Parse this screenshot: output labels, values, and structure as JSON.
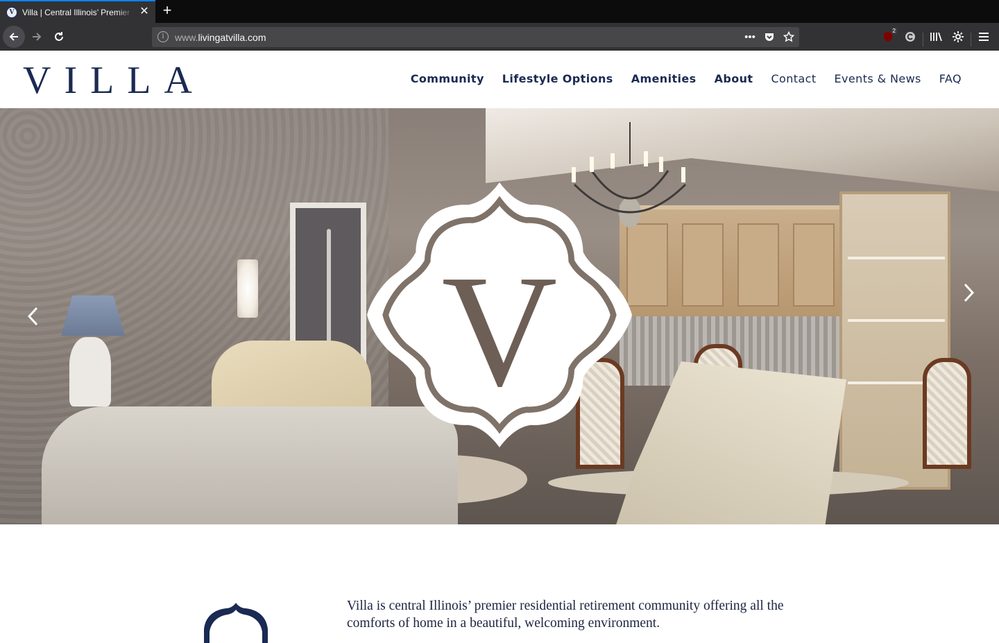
{
  "browser": {
    "tab_title": "Villa | Central Illinois’ Premier Residential Retirement Community",
    "tab_favicon_letter": "V",
    "url_dim": "www.",
    "url_host": "livingatvilla.com",
    "extension_badge": "2",
    "icons": {
      "back": "back-arrow-icon",
      "forward": "forward-arrow-icon",
      "reload": "reload-icon",
      "info": "info-icon",
      "more": "more-dots-icon",
      "pocket": "pocket-icon",
      "star": "bookmark-star-icon",
      "library": "library-icon",
      "settings": "gear-icon",
      "menu": "hamburger-menu-icon"
    }
  },
  "site": {
    "logo_text": "VILLA",
    "nav": [
      {
        "label": "Community",
        "bold": true
      },
      {
        "label": "Lifestyle Options",
        "bold": true
      },
      {
        "label": "Amenities",
        "bold": true
      },
      {
        "label": "About",
        "bold": true
      },
      {
        "label": "Contact",
        "bold": false
      },
      {
        "label": "Events & News",
        "bold": false
      },
      {
        "label": "FAQ",
        "bold": false
      }
    ],
    "hero": {
      "emblem_letter": "V",
      "prev_glyph": "‹",
      "next_glyph": "›"
    },
    "intro": {
      "text": "Villa is central Illinois’ premier residential retirement community offering all the comforts of home in a beautiful, welcoming environment."
    },
    "colors": {
      "brand_navy": "#1a2a52",
      "browser_dark": "#323234",
      "tab_accent": "#0a84ff"
    }
  }
}
